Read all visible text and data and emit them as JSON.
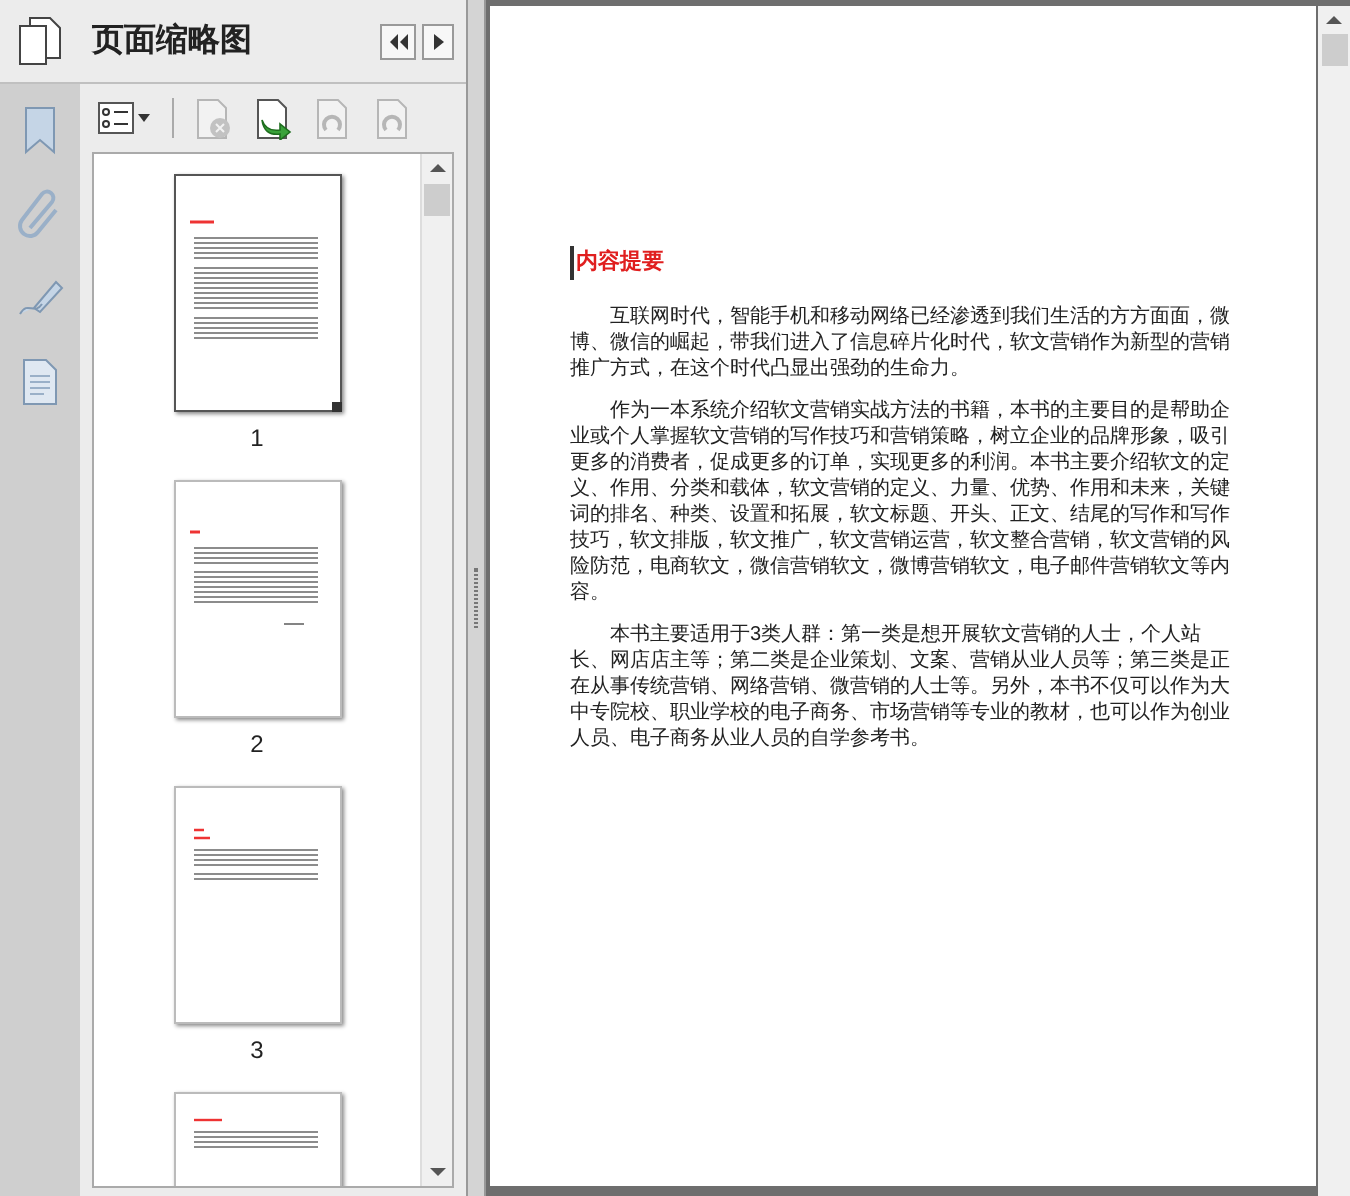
{
  "side_rail": {
    "items": [
      {
        "kind": "bookmark",
        "selected": false
      },
      {
        "kind": "attachment",
        "selected": false
      },
      {
        "kind": "signature",
        "selected": false
      },
      {
        "kind": "pages",
        "selected": false
      }
    ]
  },
  "panel": {
    "title": "页面缩略图",
    "toolbar": [
      {
        "kind": "options",
        "disabled": false
      },
      {
        "kind": "delete",
        "disabled": true
      },
      {
        "kind": "insert",
        "disabled": false
      },
      {
        "kind": "rotate_left",
        "disabled": true
      },
      {
        "kind": "rotate_right",
        "disabled": true
      }
    ],
    "thumbnails": [
      {
        "label": "1",
        "selected": true,
        "kind": "summary"
      },
      {
        "label": "2",
        "selected": false,
        "kind": "short"
      },
      {
        "label": "3",
        "selected": false,
        "kind": "heading"
      },
      {
        "selected": false,
        "kind": "partial"
      }
    ]
  },
  "document": {
    "heading": "内容提要",
    "paragraphs": [
      "互联网时代，智能手机和移动网络已经渗透到我们生活的方方面面，微博、微信的崛起，带我们进入了信息碎片化时代，软文营销作为新型的营销推广方式，在这个时代凸显出强劲的生命力。",
      "作为一本系统介绍软文营销实战方法的书籍，本书的主要目的是帮助企业或个人掌握软文营销的写作技巧和营销策略，树立企业的品牌形象，吸引更多的消费者，促成更多的订单，实现更多的利润。本书主要介绍软文的定义、作用、分类和载体，软文营销的定义、力量、优势、作用和未来，关键词的排名、种类、设置和拓展，软文标题、开头、正文、结尾的写作和写作技巧，软文排版，软文推广，软文营销运营，软文整合营销，软文营销的风险防范，电商软文，微信营销软文，微博营销软文，电子邮件营销软文等内容。",
      "本书主要适用于3类人群：第一类是想开展软文营销的人士，个人站长、网店店主等；第二类是企业策划、文案、营销从业人员等；第三类是正在从事传统营销、网络营销、微营销的人士等。另外，本书不仅可以作为大中专院校、职业学校的电子商务、市场营销等专业的教材，也可以作为创业人员、电子商务从业人员的自学参考书。"
    ]
  }
}
